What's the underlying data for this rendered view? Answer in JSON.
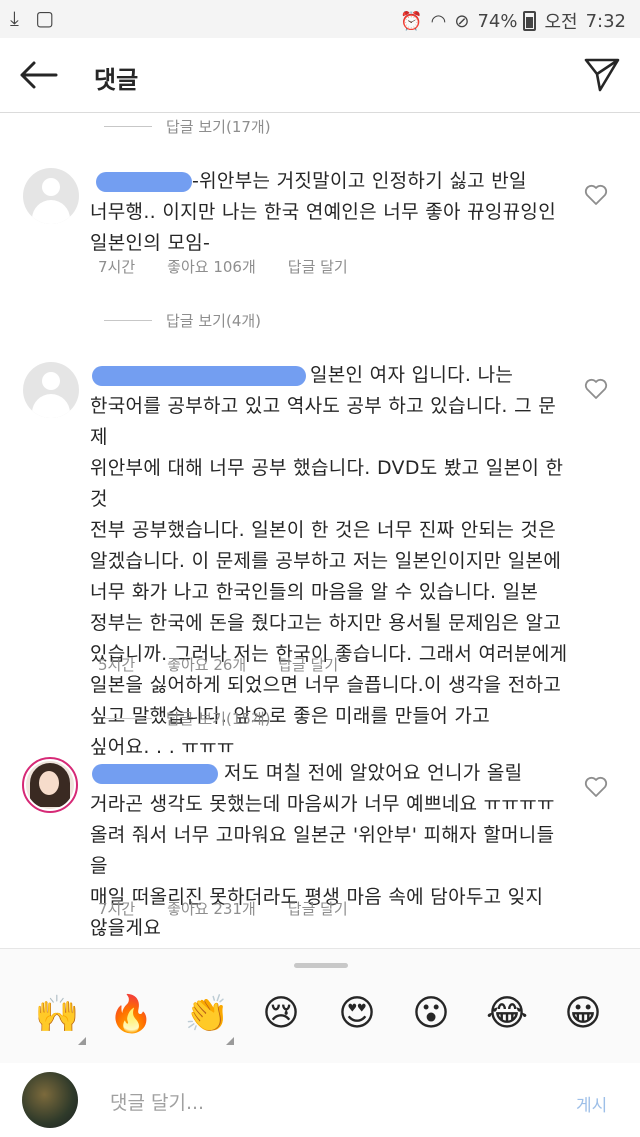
{
  "statusbar": {
    "battery": "74%",
    "ampm": "오전",
    "time": "7:32"
  },
  "header": {
    "title": "댓글"
  },
  "threads": [
    {
      "view_replies": "답글 보기(17개)"
    },
    {
      "text": "-위안부는 거짓말이고 인정하기 싫고 반일\n너무행.. 이지만 나는 한국 연예인은 너무 좋아 뀨잉뀨잉인\n일본인의 모임-",
      "time": "7시간",
      "likes": "좋아요 106개",
      "reply": "답글 달기",
      "view_replies": "답글 보기(4개)"
    },
    {
      "text": "일본인 여자 입니다. 나는\n한국어를 공부하고 있고 역사도 공부 하고 있습니다. 그 문제\n위안부에 대해 너무 공부 했습니다. DVD도 봤고 일본이 한 것\n전부 공부했습니다. 일본이 한 것은 너무 진짜 안되는 것은\n알겠습니다. 이 문제를 공부하고 저는 일본인이지만 일본에\n너무 화가 나고 한국인들의 마음을 알 수 있습니다. 일본\n정부는 한국에 돈을 줬다고는 하지만 용서될 문제임은 알고\n있습니까. 그러나 저는 한국이 좋습니다. 그래서 여러분에게\n일본을 싫어하게 되었으면 너무 슬픕니다.이 생각을 전하고\n싶고 말했습니다. 앞으로 좋은 미래를 만들어 가고\n싶어요. . . ㅠㅠㅠ",
      "time": "5시간",
      "likes": "좋아요 26개",
      "reply": "답글 달기",
      "view_replies": "답글 보기(15개)"
    },
    {
      "text": "저도 며칠 전에 알았어요 언니가 올릴\n거라곤 생각도 못했는데 마음씨가 너무 예쁘네요 ㅠㅠㅠㅠ\n올려 줘서 너무 고마워요 일본군 '위안부' 피해자 할머니들을\n매일 떠올리진 못하더라도 평생 마음 속에 담아두고 잊지\n않을게요",
      "time": "7시간",
      "likes": "좋아요 231개",
      "reply": "답글 달기"
    }
  ],
  "reactions": [
    "🙌",
    "🔥",
    "👏",
    "😢",
    "😍",
    "😮",
    "😂",
    "😀"
  ],
  "input": {
    "placeholder": "댓글 달기...",
    "post_label": "게시"
  },
  "colors": {
    "blur_mask": "#5b8def",
    "muted_text": "#8e8e8e",
    "post_button": "#9dbfe8"
  }
}
